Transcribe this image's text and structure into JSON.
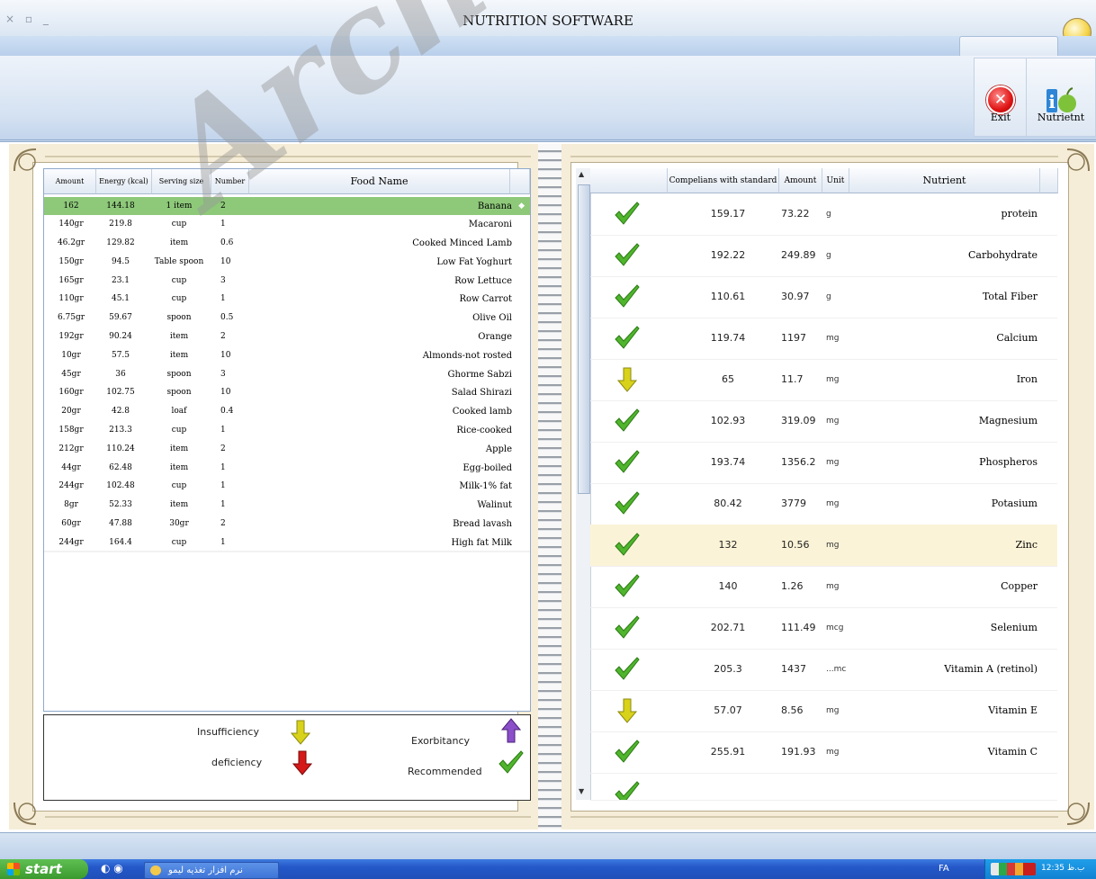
{
  "window": {
    "controls": "× ▫ _",
    "title": "NUTRITION SOFTWARE"
  },
  "ribbon": {
    "exit_label": "Exit",
    "nutrient_label": "Nutrietnt"
  },
  "food_table": {
    "headers": {
      "amount": "Amount",
      "energy": "Energy (kcal)",
      "serving": "Serving size",
      "number": "Number",
      "food": "Food Name"
    },
    "selected_index": 0,
    "rows": [
      {
        "amount": "162",
        "energy": "144.18",
        "serving": "1 item",
        "number": "2",
        "food": "Banana"
      },
      {
        "amount": "140gr",
        "energy": "219.8",
        "serving": "cup",
        "number": "1",
        "food": "Macaroni"
      },
      {
        "amount": "46.2gr",
        "energy": "129.82",
        "serving": "item",
        "number": "0.6",
        "food": "Cooked Minced Lamb"
      },
      {
        "amount": "150gr",
        "energy": "94.5",
        "serving": "Table spoon",
        "number": "10",
        "food": "Low Fat Yoghurt"
      },
      {
        "amount": "165gr",
        "energy": "23.1",
        "serving": "cup",
        "number": "3",
        "food": "Row Lettuce"
      },
      {
        "amount": "110gr",
        "energy": "45.1",
        "serving": "cup",
        "number": "1",
        "food": "Row Carrot"
      },
      {
        "amount": "6.75gr",
        "energy": "59.67",
        "serving": "spoon",
        "number": "0.5",
        "food": "Olive Oil"
      },
      {
        "amount": "192gr",
        "energy": "90.24",
        "serving": "item",
        "number": "2",
        "food": "Orange"
      },
      {
        "amount": "10gr",
        "energy": "57.5",
        "serving": "item",
        "number": "10",
        "food": "Almonds-not rosted"
      },
      {
        "amount": "45gr",
        "energy": "36",
        "serving": "spoon",
        "number": "3",
        "food": "Ghorme Sabzi"
      },
      {
        "amount": "160gr",
        "energy": "102.75",
        "serving": "spoon",
        "number": "10",
        "food": "Salad Shirazi"
      },
      {
        "amount": "20gr",
        "energy": "42.8",
        "serving": "loaf",
        "number": "0.4",
        "food": "Cooked lamb"
      },
      {
        "amount": "158gr",
        "energy": "213.3",
        "serving": "cup",
        "number": "1",
        "food": "Rice-cooked"
      },
      {
        "amount": "212gr",
        "energy": "110.24",
        "serving": "item",
        "number": "2",
        "food": "Apple"
      },
      {
        "amount": "44gr",
        "energy": "62.48",
        "serving": "item",
        "number": "1",
        "food": "Egg-boiled"
      },
      {
        "amount": "244gr",
        "energy": "102.48",
        "serving": "cup",
        "number": "1",
        "food": "Milk-1% fat"
      },
      {
        "amount": "8gr",
        "energy": "52.33",
        "serving": "item",
        "number": "1",
        "food": "Walinut"
      },
      {
        "amount": "60gr",
        "energy": "47.88",
        "serving": "30gr",
        "number": "2",
        "food": "Bread lavash"
      },
      {
        "amount": "244gr",
        "energy": "164.4",
        "serving": "cup",
        "number": "1",
        "food": "High fat Milk"
      }
    ]
  },
  "legend": {
    "insufficiency": "Insufficiency",
    "deficiency": "deficiency",
    "exorbitancy": "Exorbitancy",
    "recommended": "Recommended"
  },
  "nutrient_table": {
    "headers": {
      "compliance": "Compelians with standard",
      "amount": "Amount",
      "unit": "Unit",
      "nutrient": "Nutrient"
    },
    "selected_index": 8,
    "rows": [
      {
        "status": "check-icon",
        "compliance": "159.17",
        "amount": "73.22",
        "unit": "g",
        "nutrient": "protein"
      },
      {
        "status": "check-icon",
        "compliance": "192.22",
        "amount": "249.89",
        "unit": "g",
        "nutrient": "Carbohydrate"
      },
      {
        "status": "check-icon",
        "compliance": "110.61",
        "amount": "30.97",
        "unit": "g",
        "nutrient": "Total Fiber"
      },
      {
        "status": "check-icon",
        "compliance": "119.74",
        "amount": "1197",
        "unit": "mg",
        "nutrient": "Calcium"
      },
      {
        "status": "yellow-down-arrow-icon",
        "compliance": "65",
        "amount": "11.7",
        "unit": "mg",
        "nutrient": "Iron"
      },
      {
        "status": "check-icon",
        "compliance": "102.93",
        "amount": "319.09",
        "unit": "mg",
        "nutrient": "Magnesium"
      },
      {
        "status": "check-icon",
        "compliance": "193.74",
        "amount": "1356.2",
        "unit": "mg",
        "nutrient": "Phospheros"
      },
      {
        "status": "check-icon",
        "compliance": "80.42",
        "amount": "3779",
        "unit": "mg",
        "nutrient": "Potasium"
      },
      {
        "status": "check-icon",
        "compliance": "132",
        "amount": "10.56",
        "unit": "mg",
        "nutrient": "Zinc"
      },
      {
        "status": "check-icon",
        "compliance": "140",
        "amount": "1.26",
        "unit": "mg",
        "nutrient": "Copper"
      },
      {
        "status": "check-icon",
        "compliance": "202.71",
        "amount": "111.49",
        "unit": "mcg",
        "nutrient": "Selenium"
      },
      {
        "status": "check-icon",
        "compliance": "205.3",
        "amount": "1437",
        "unit": "...mc",
        "nutrient": "Vitamin A (retinol)"
      },
      {
        "status": "yellow-down-arrow-icon",
        "compliance": "57.07",
        "amount": "8.56",
        "unit": "mg",
        "nutrient": "Vitamin E"
      },
      {
        "status": "check-icon",
        "compliance": "255.91",
        "amount": "191.93",
        "unit": "mg",
        "nutrient": "Vitamin C"
      },
      {
        "status": "check-icon",
        "compliance": "",
        "amount": "",
        "unit": "",
        "nutrient": ""
      }
    ]
  },
  "taskbar": {
    "start_label": "start",
    "task_label": "نرم افزار تغذیه لیمو",
    "language": "FA",
    "clock": "12:35 ب.ظ"
  },
  "watermark": "Archive of SID",
  "colors": {
    "selection_green": "#8ec97a",
    "selection_yellow": "#fbf3d7",
    "check_green": "#4fb52c",
    "arrow_yellow": "#d9d21a",
    "arrow_red": "#d51919",
    "arrow_purple": "#8b4fc9"
  }
}
